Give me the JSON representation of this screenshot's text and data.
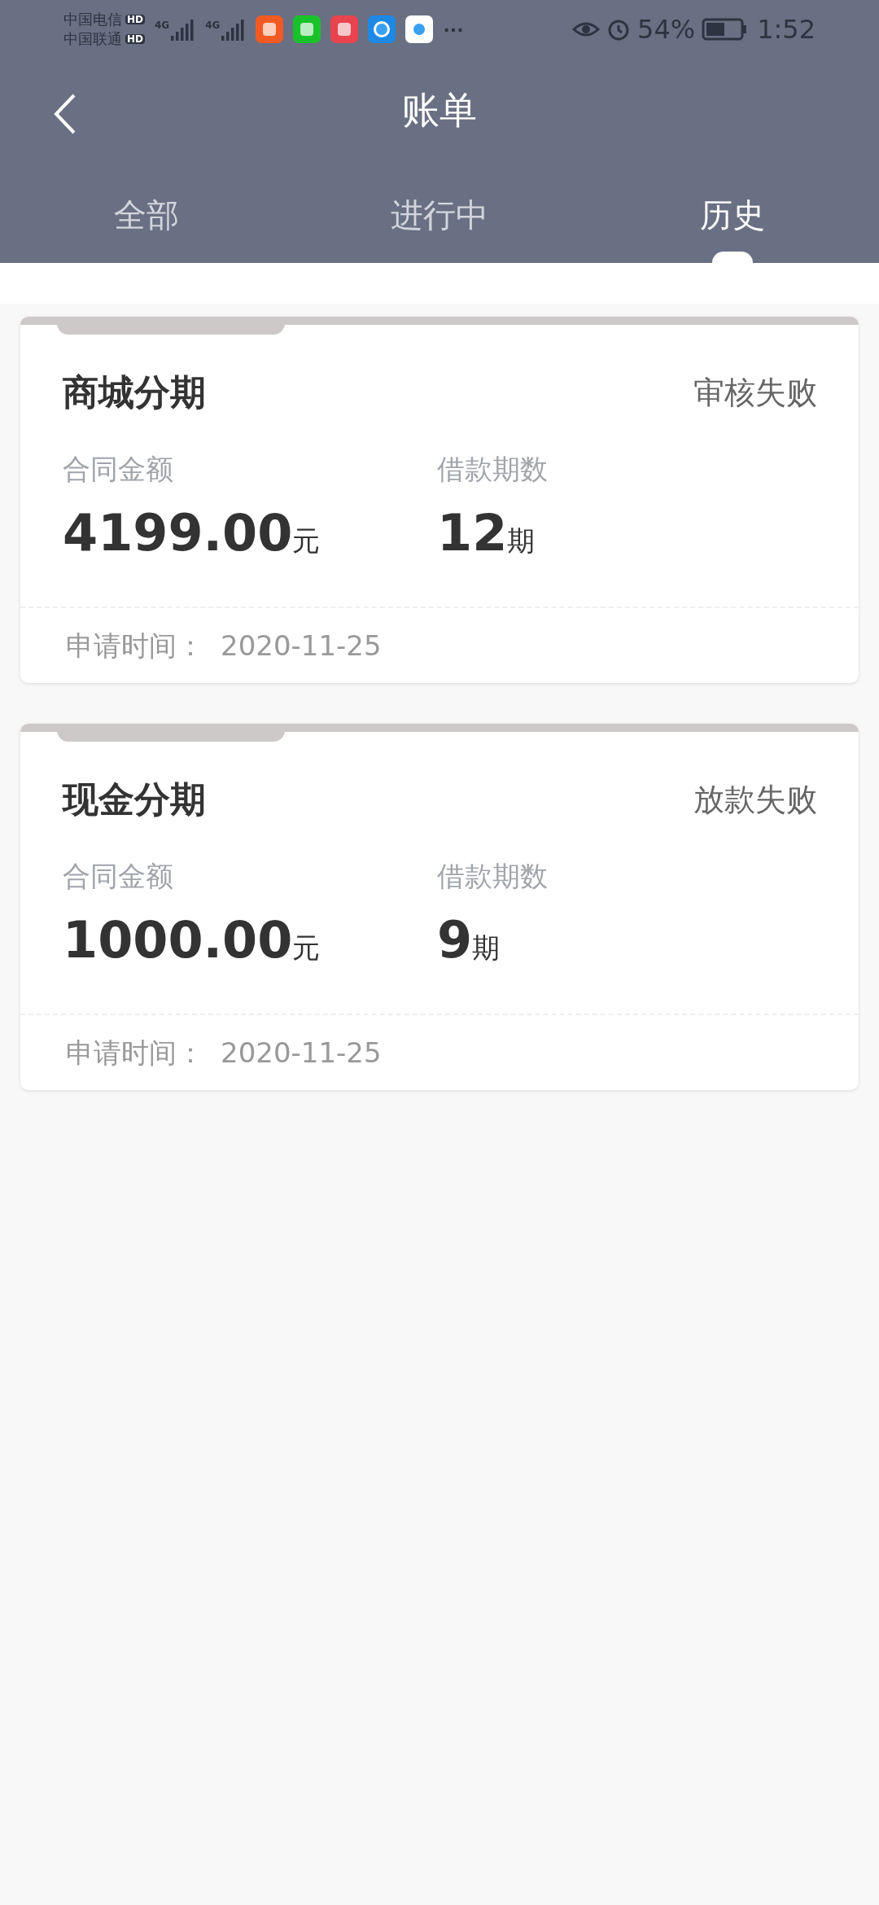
{
  "status_bar": {
    "carriers": [
      {
        "name": "中国电信",
        "badge": "HD"
      },
      {
        "name": "中国联通",
        "badge": "HD"
      }
    ],
    "signals": [
      "4G",
      "4G"
    ],
    "more": "···",
    "battery": "54%",
    "time": "1:52"
  },
  "header": {
    "title": "账单"
  },
  "tabs": [
    {
      "label": "全部",
      "selected": false
    },
    {
      "label": "进行中",
      "selected": false
    },
    {
      "label": "历史",
      "selected": true
    }
  ],
  "bills": [
    {
      "title": "商城分期",
      "status": "审核失败",
      "amount_label": "合同金额",
      "amount": "4199.00",
      "amount_unit": "元",
      "term_label": "借款期数",
      "term": "12",
      "term_unit": "期",
      "date_label": "申请时间：",
      "date": "2020-11-25"
    },
    {
      "title": "现金分期",
      "status": "放款失败",
      "amount_label": "合同金额",
      "amount": "1000.00",
      "amount_unit": "元",
      "term_label": "借款期数",
      "term": "9",
      "term_unit": "期",
      "date_label": "申请时间：",
      "date": "2020-11-25"
    }
  ]
}
